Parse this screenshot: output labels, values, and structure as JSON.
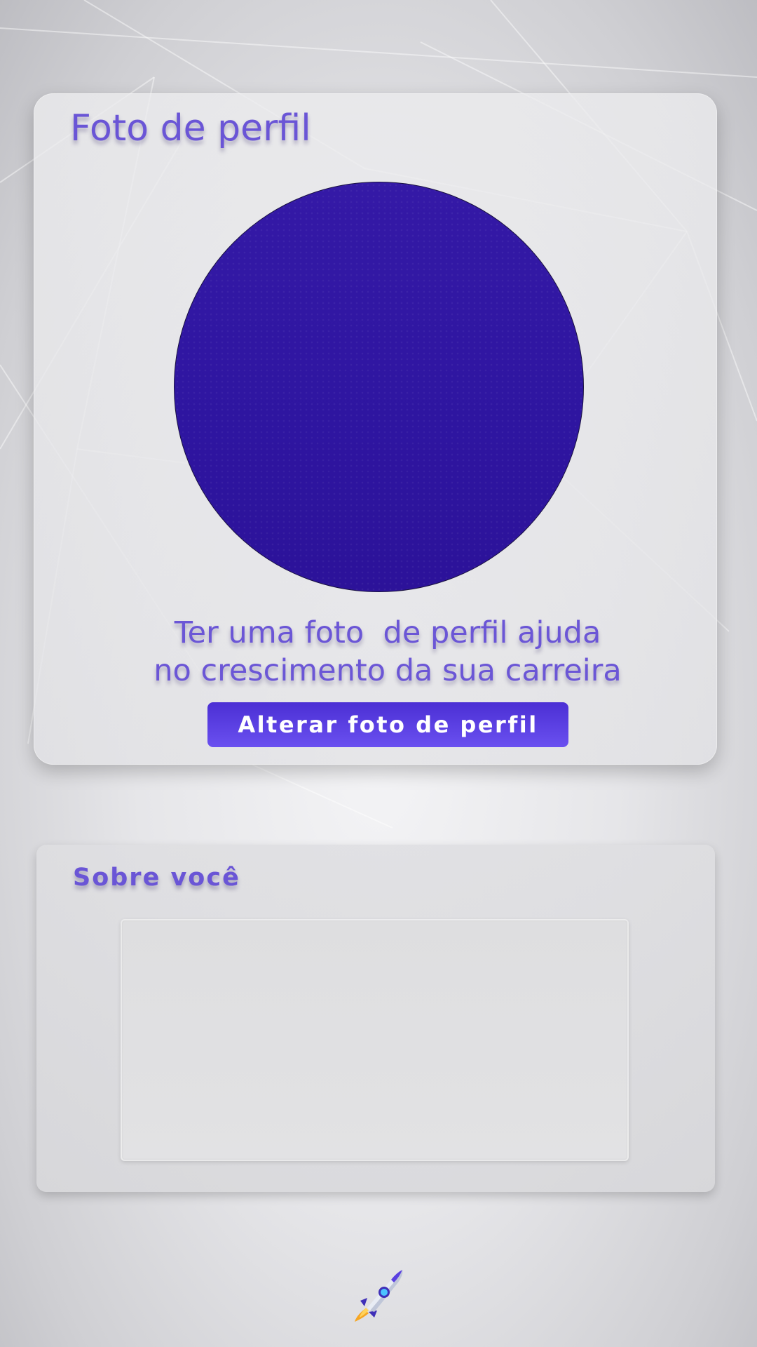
{
  "profile_photo_card": {
    "title": "Foto de perfil",
    "helper_text_line1": "Ter uma foto  de perfil ajuda",
    "helper_text_line2": "no crescimento da sua carreira",
    "change_button_label": "Alterar foto de perfil",
    "avatar_color": "#2f16a3"
  },
  "about_card": {
    "title": "Sobre você",
    "bio_value": "",
    "bio_placeholder": ""
  },
  "footer": {
    "icon": "rocket-icon"
  },
  "colors": {
    "accent_text": "#6a55d6",
    "button_gradient_start": "#4b2fd4",
    "button_gradient_end": "#6a50f0",
    "background": "#e6e6e9"
  }
}
